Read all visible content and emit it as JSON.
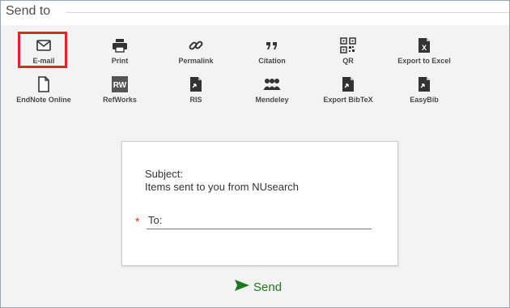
{
  "header": {
    "title": "Send to"
  },
  "actions": [
    {
      "label": "E-mail",
      "icon": "envelope-icon",
      "selected": true
    },
    {
      "label": "Print",
      "icon": "printer-icon"
    },
    {
      "label": "Permalink",
      "icon": "link-icon"
    },
    {
      "label": "Citation",
      "icon": "quote-icon"
    },
    {
      "label": "QR",
      "icon": "qr-code-icon"
    },
    {
      "label": "Export to Excel",
      "icon": "excel-file-icon"
    },
    {
      "label": "EndNote Online",
      "icon": "document-icon"
    },
    {
      "label": "RefWorks",
      "icon": "refworks-icon",
      "icon_text": "RW"
    },
    {
      "label": "RIS",
      "icon": "file-export-icon"
    },
    {
      "label": "Mendeley",
      "icon": "mendeley-icon"
    },
    {
      "label": "Export BibTeX",
      "icon": "file-export-icon"
    },
    {
      "label": "EasyBib",
      "icon": "file-export-icon"
    }
  ],
  "email_form": {
    "subject_label": "Subject:",
    "subject_value": "Items sent to you from NUsearch",
    "required_marker": "*",
    "to_label": "To:",
    "to_value": ""
  },
  "send_button": {
    "label": "Send"
  },
  "colors": {
    "highlight": "#e0252a",
    "send": "#1f7a1f",
    "required": "#d9302c",
    "panel_bg": "#f3f3f3"
  }
}
